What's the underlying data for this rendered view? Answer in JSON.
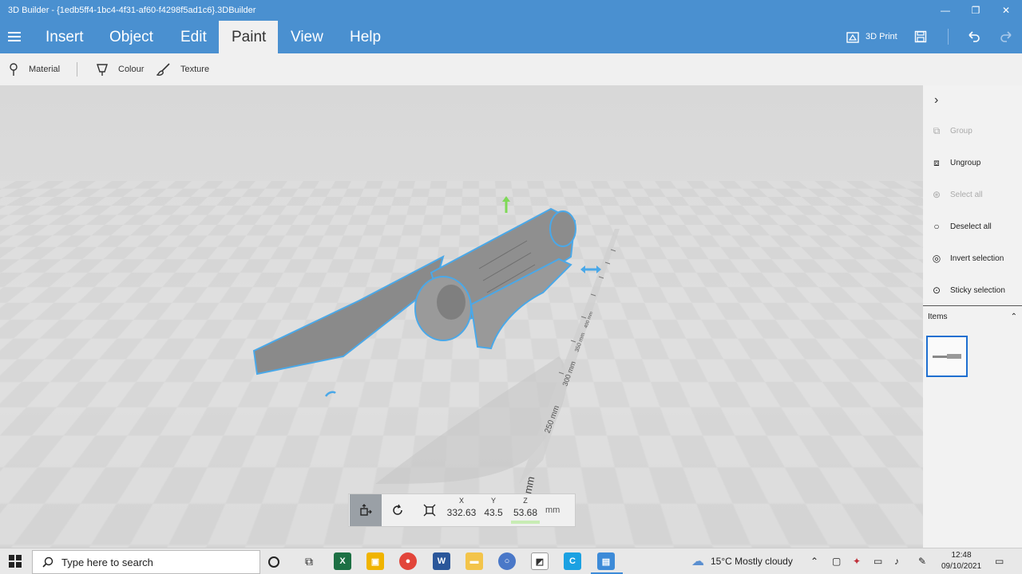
{
  "window": {
    "title": "3D Builder - {1edb5ff4-1bc4-4f31-af60-f4298f5ad1c6}.3DBuilder",
    "min_label": "—",
    "max_label": "❐",
    "close_label": "✕"
  },
  "ribbon": {
    "tabs": [
      "Insert",
      "Object",
      "Edit",
      "Paint",
      "View",
      "Help"
    ],
    "active_tab": "Paint",
    "print_label": "3D Print"
  },
  "subbar": {
    "material": "Material",
    "colour": "Colour",
    "texture": "Texture"
  },
  "panel": {
    "group": "Group",
    "ungroup": "Ungroup",
    "select_all": "Select all",
    "deselect_all": "Deselect all",
    "invert_selection": "Invert selection",
    "sticky_selection": "Sticky selection",
    "items_label": "Items"
  },
  "viewport": {
    "ruler_labels": [
      "250 mm",
      "300 mm",
      "350 mm",
      "400 mm",
      "mm"
    ]
  },
  "transform": {
    "x_label": "X",
    "x_value": "332.63",
    "y_label": "Y",
    "y_value": "43.5",
    "z_label": "Z",
    "z_value": "53.68",
    "unit": "mm"
  },
  "taskbar": {
    "search_placeholder": "Type here to search",
    "weather": "15°C  Mostly cloudy",
    "time": "12:48",
    "date": "09/10/2021"
  },
  "colors": {
    "accent": "#4a90d0",
    "selection_outline": "#4aa8e8",
    "gizmo_green": "#7ed957"
  }
}
